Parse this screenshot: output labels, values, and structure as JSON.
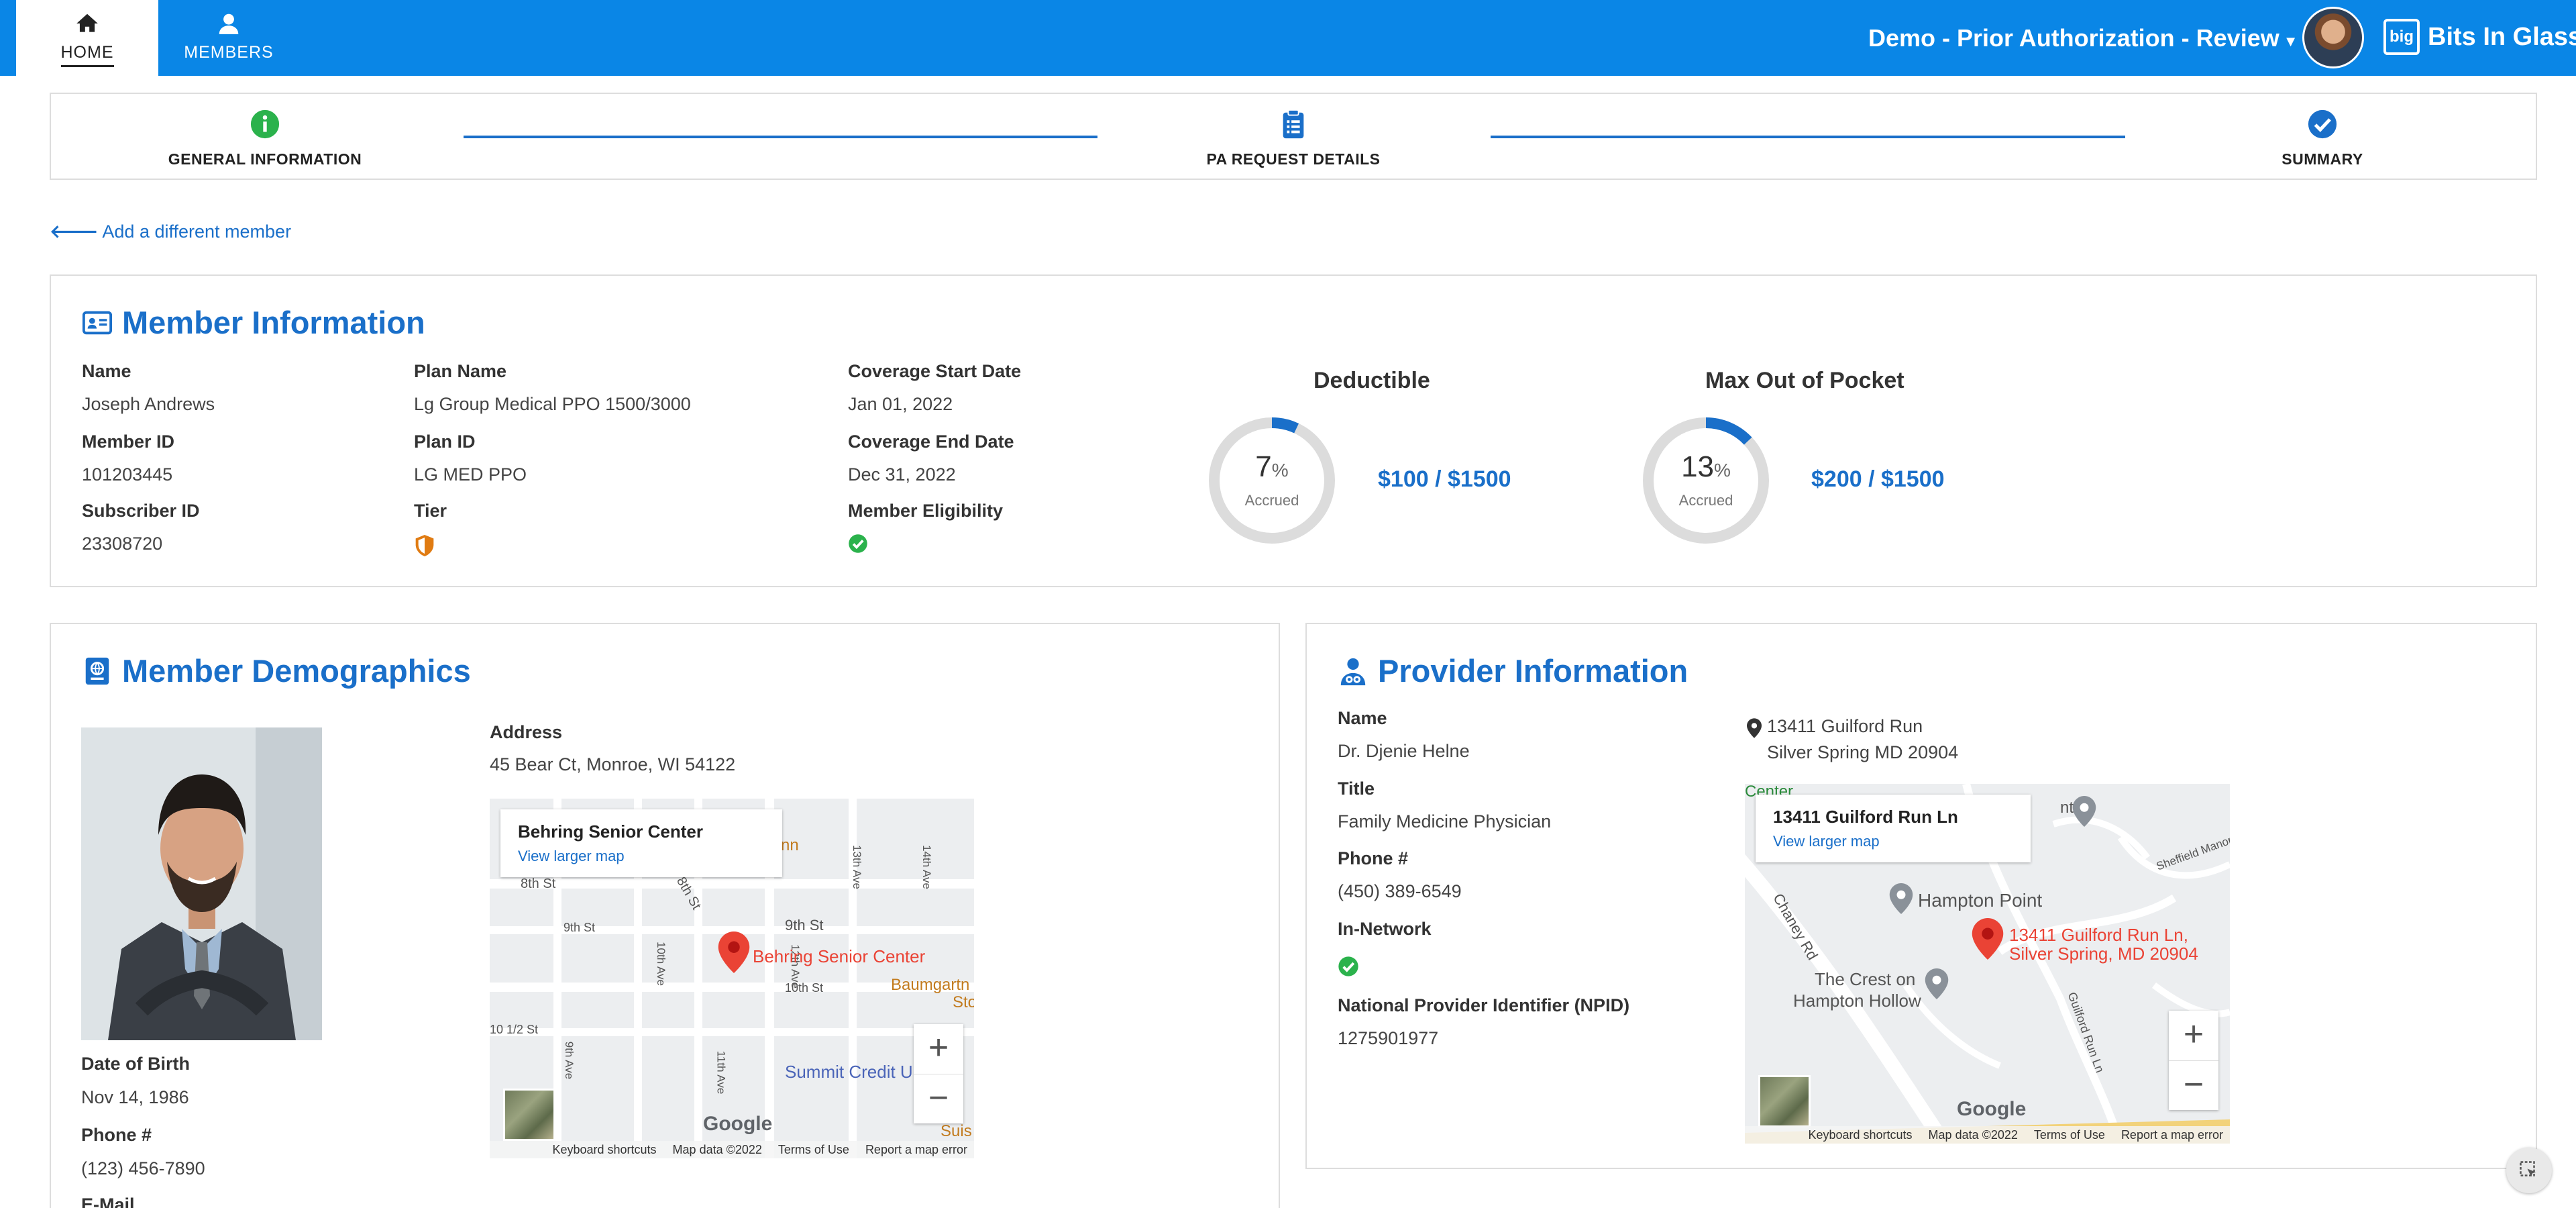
{
  "nav": {
    "home_label": "HOME",
    "members_label": "MEMBERS",
    "app_title": "Demo - Prior Authorization - Review",
    "brand_name": "Bits In Glass",
    "brand_mark": "big",
    "color": "#0a86e6"
  },
  "stepper": {
    "steps": [
      {
        "label": "GENERAL INFORMATION",
        "icon": "info-circle-icon",
        "color": "#2bb24c"
      },
      {
        "label": "PA REQUEST DETAILS",
        "icon": "clipboard-icon",
        "color": "#1a6fc9"
      },
      {
        "label": "SUMMARY",
        "icon": "check-circle-icon",
        "color": "#1a6fc9"
      }
    ]
  },
  "back_link": "Add a different member",
  "member_info": {
    "title": "Member Information",
    "name_label": "Name",
    "name": "Joseph Andrews",
    "member_id_label": "Member ID",
    "member_id": "101203445",
    "subscriber_id_label": "Subscriber ID",
    "subscriber_id": "23308720",
    "plan_name_label": "Plan Name",
    "plan_name": "Lg Group Medical PPO 1500/3000",
    "plan_id_label": "Plan ID",
    "plan_id": "LG MED PPO",
    "tier_label": "Tier",
    "coverage_start_label": "Coverage Start Date",
    "coverage_start": "Jan 01, 2022",
    "coverage_end_label": "Coverage End Date",
    "coverage_end": "Dec 31, 2022",
    "eligibility_label": "Member Eligibility",
    "deductible": {
      "title": "Deductible",
      "percent": "7",
      "percent_unit": "%",
      "sub": "Accrued",
      "fraction": 0.07,
      "amount": "$100 / $1500"
    },
    "max_oop": {
      "title": "Max Out of Pocket",
      "percent": "13",
      "percent_unit": "%",
      "sub": "Accrued",
      "fraction": 0.13,
      "amount": "$200 / $1500"
    }
  },
  "demographics": {
    "title": "Member Demographics",
    "address_label": "Address",
    "address": "45 Bear Ct, Monroe, WI 54122",
    "dob_label": "Date of Birth",
    "dob": "Nov 14, 1986",
    "phone_label": "Phone #",
    "phone": "(123) 456-7890",
    "email_label": "E-Mail",
    "map": {
      "info_title": "Behring Senior Center",
      "info_link": "View larger map",
      "pin_label": "Behring Senior Center",
      "streets": [
        "8th St",
        "9th St",
        "9th St",
        "10th St",
        "10 1/2 St",
        "10th Ave",
        "11th Ave",
        "12th Ave",
        "13th Ave",
        "14th Ave",
        "8th St",
        "9th Ave",
        "Baumgartn",
        "Summit Credit U",
        "Sto",
        "Suis",
        "nn"
      ],
      "footer": [
        "Keyboard shortcuts",
        "Map data ©2022",
        "Terms of Use",
        "Report a map error"
      ]
    }
  },
  "provider": {
    "title": "Provider Information",
    "name_label": "Name",
    "name": "Dr. Djenie Helne",
    "title_label": "Title",
    "title_value": "Family Medicine Physician",
    "phone_label": "Phone #",
    "phone": "(450) 389-6549",
    "network_label": "In-Network",
    "npid_label": "National Provider Identifier (NPID)",
    "npid": "1275901977",
    "address_line1": "13411 Guilford Run",
    "address_line2": "Silver Spring MD 20904",
    "map": {
      "info_title": "13411 Guilford Run Ln",
      "info_link": "View larger map",
      "pin_label_1": "13411 Guilford Run Ln,",
      "pin_label_2": "Silver Spring, MD 20904",
      "places": [
        "Hampton Point",
        "The Crest on",
        "Hampton Hollow",
        "Chaney Rd",
        "Guilford Run Ln",
        "Sheffield Manor Dr",
        "nts",
        "Center"
      ],
      "footer": [
        "Keyboard shortcuts",
        "Map data ©2022",
        "Terms of Use",
        "Report a map error"
      ]
    }
  },
  "google_label": "Google",
  "zoom_in": "+",
  "zoom_out": "−"
}
